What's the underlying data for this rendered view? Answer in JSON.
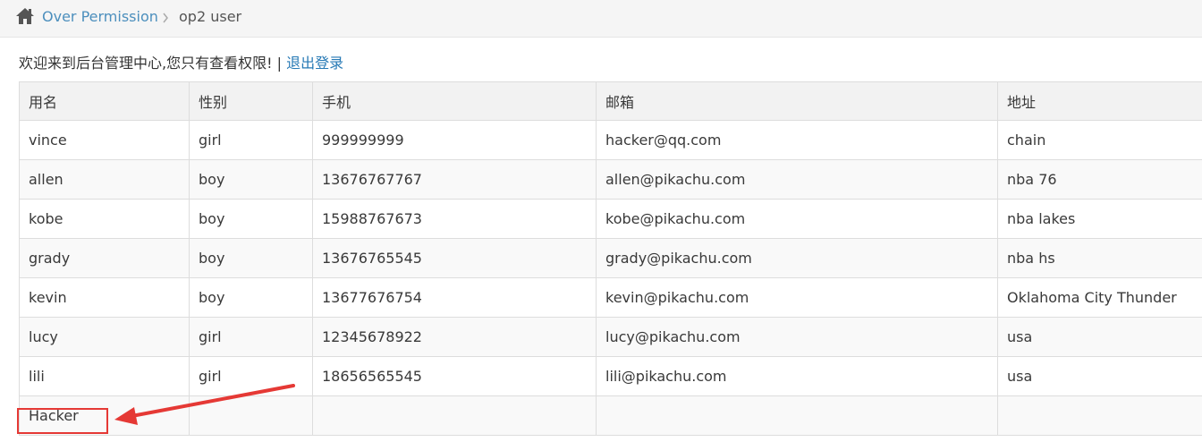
{
  "breadcrumb": {
    "home_icon": "home-icon",
    "link_label": "Over Permission",
    "separator_icon": "chevron-right-icon",
    "current_label": "op2 user"
  },
  "welcome": {
    "message": "欢迎来到后台管理中心,您只有查看权限!",
    "divider": "|",
    "logout_label": "退出登录"
  },
  "table": {
    "headers": [
      "用名",
      "性别",
      "手机",
      "邮箱",
      "地址"
    ],
    "rows": [
      [
        "vince",
        "girl",
        "999999999",
        "hacker@qq.com",
        "chain"
      ],
      [
        "allen",
        "boy",
        "13676767767",
        "allen@pikachu.com",
        "nba 76"
      ],
      [
        "kobe",
        "boy",
        "15988767673",
        "kobe@pikachu.com",
        "nba lakes"
      ],
      [
        "grady",
        "boy",
        "13676765545",
        "grady@pikachu.com",
        "nba hs"
      ],
      [
        "kevin",
        "boy",
        "13677676754",
        "kevin@pikachu.com",
        "Oklahoma City Thunder"
      ],
      [
        "lucy",
        "girl",
        "12345678922",
        "lucy@pikachu.com",
        "usa"
      ],
      [
        "lili",
        "girl",
        "18656565545",
        "lili@pikachu.com",
        "usa"
      ],
      [
        "Hacker",
        "",
        "",
        "",
        ""
      ]
    ]
  },
  "annotation": {
    "color": "#e53935"
  },
  "colors": {
    "link": "#4c8fbd",
    "logout": "#2679b5",
    "header_bg": "#f2f2f2",
    "stripe_bg": "#f9f9f9"
  }
}
